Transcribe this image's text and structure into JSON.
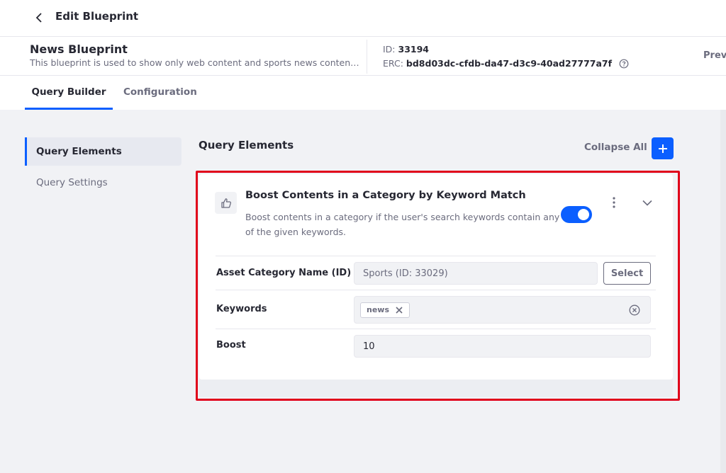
{
  "header": {
    "title": "Edit Blueprint"
  },
  "blueprint": {
    "name": "News Blueprint",
    "description": "This blueprint is used to show only web content and sports news conten…",
    "id_label": "ID:",
    "id_value": "33194",
    "erc_label": "ERC:",
    "erc_value": "bd8d03dc-cfdb-da47-d3c9-40ad27777a7f",
    "preview_label": "Previ"
  },
  "tabs": [
    {
      "label": "Query Builder",
      "active": true
    },
    {
      "label": "Configuration",
      "active": false
    }
  ],
  "sidebar": {
    "items": [
      {
        "label": "Query Elements",
        "active": true
      },
      {
        "label": "Query Settings",
        "active": false
      }
    ]
  },
  "main": {
    "title": "Query Elements",
    "collapse_all_label": "Collapse All"
  },
  "element": {
    "title": "Boost Contents in a Category by Keyword Match",
    "description": "Boost contents in a category if the user's search keywords contain any of the given keywords.",
    "enabled": true,
    "fields": {
      "category_label": "Asset Category Name (ID)",
      "category_value": "Sports (ID: 33029)",
      "select_label": "Select",
      "keywords_label": "Keywords",
      "keywords": [
        "news"
      ],
      "boost_label": "Boost",
      "boost_value": "10"
    }
  },
  "colors": {
    "primary": "#0b5fff",
    "highlight": "#e0001a",
    "text": "#272833",
    "secondary_text": "#6b6c7e"
  },
  "icons": {
    "back": "chevron-left-icon",
    "help": "question-circle-icon",
    "add": "plus-icon",
    "element": "thumbs-up-icon",
    "menu": "ellipsis-vertical-icon",
    "expand": "chevron-down-icon",
    "remove_chip": "times-icon",
    "clear": "times-circle-icon"
  }
}
